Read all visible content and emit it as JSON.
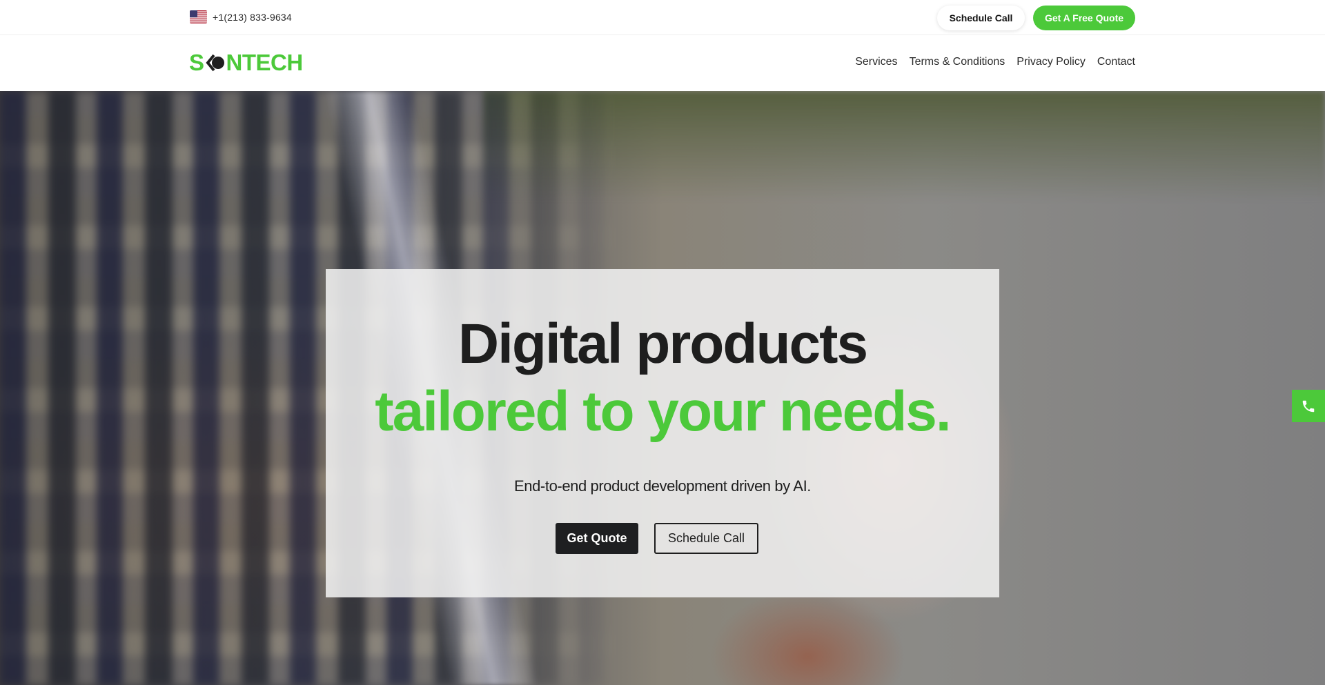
{
  "topbar": {
    "phone": "+1(213) 833-9634",
    "flag_icon": "us-flag-icon",
    "schedule_label": "Schedule Call",
    "quote_label": "Get A Free Quote"
  },
  "brand": {
    "logo_left": "S",
    "logo_right": "NTECH",
    "color": "#4cc93a"
  },
  "nav": {
    "items": [
      {
        "label": "Services"
      },
      {
        "label": "Terms & Conditions"
      },
      {
        "label": "Privacy Policy"
      },
      {
        "label": "Contact"
      }
    ]
  },
  "hero": {
    "headline_line1": "Digital products",
    "headline_line2": "tailored to your needs.",
    "subheading": "End-to-end product development driven by AI.",
    "primary_cta": "Get Quote",
    "secondary_cta": "Schedule Call"
  },
  "floating": {
    "icon": "phone-icon",
    "accent": "#4cc93a"
  }
}
